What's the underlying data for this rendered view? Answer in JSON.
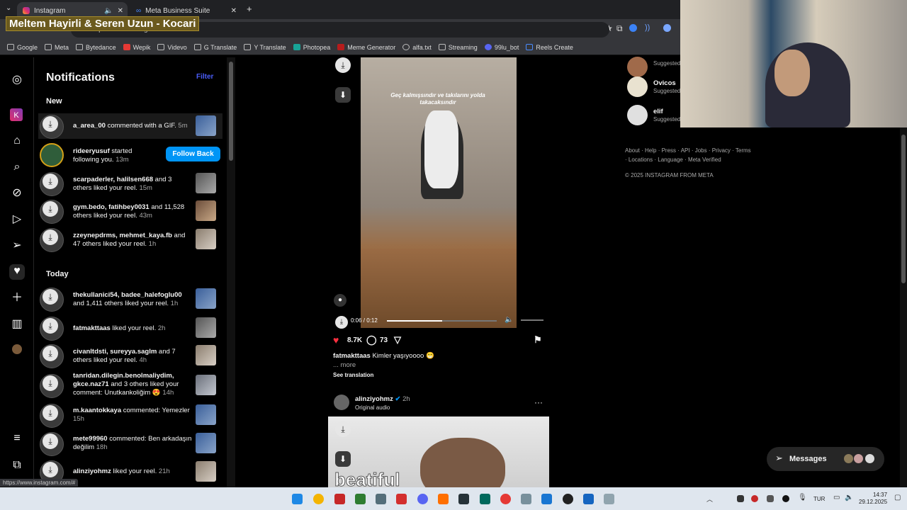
{
  "browser": {
    "tabs": [
      {
        "title": "Instagram",
        "active": true
      },
      {
        "title": "Meta Business Suite",
        "active": false
      }
    ],
    "new_tab_label": "+",
    "url": "https://www.instagram.com",
    "overlay_title": "Meltem Hayirli & Seren Uzun - Kocari",
    "bookmarks": [
      "Google",
      "Meta",
      "Bytedance",
      "Wepik",
      "Videvo",
      "G Translate",
      "Y Translate",
      "Photopea",
      "Meme Generator",
      "alfa.txt",
      "Streaming",
      "99lu_bot",
      "Reels Create"
    ],
    "status_url": "https://www.instagram.com/#"
  },
  "rail": {
    "icons": [
      "instagram-logo",
      "k-app",
      "home",
      "search",
      "explore",
      "reels",
      "messages",
      "notifications",
      "create",
      "dashboard",
      "profile",
      "more",
      "threads"
    ]
  },
  "notifications": {
    "title": "Notifications",
    "filter_label": "Filter",
    "sections": {
      "new": "New",
      "today": "Today"
    },
    "new_items": [
      {
        "user": "a_area_00",
        "text": " commented with a GIF.",
        "time": "5m"
      },
      {
        "user": "rideeryusuf",
        "text": " started following you.",
        "time": "13m",
        "button": "Follow Back"
      },
      {
        "user": "scarpaderler, halilsen668",
        "text": " and 3 others liked your reel.",
        "time": "15m"
      },
      {
        "user": "gym.bedo, fatihbey0031",
        "text": " and 11,528 others liked your reel.",
        "time": "43m"
      },
      {
        "user": "zzeynepdrms, mehmet_kaya.fb",
        "text": " and 47 others liked your reel.",
        "time": "1h"
      }
    ],
    "today_items": [
      {
        "user": "thekullanici54, badee_halefoglu00",
        "text": " and 1,411 others liked your reel.",
        "time": "1h"
      },
      {
        "user": "fatmakttaas",
        "text": " liked your reel.",
        "time": "2h"
      },
      {
        "user": "civanltdsti, sureyya.saglm",
        "text": " and 7 others liked your reel.",
        "time": "4h"
      },
      {
        "user": "tanridan.dilegin.benolmaliydim, gkce.naz71",
        "text": " and 3 others liked your comment: Unutkankoliğim 😍",
        "time": "14h"
      },
      {
        "user": "m.kaantokkaya",
        "text": " commented: Yemezler",
        "time": "15h"
      },
      {
        "user": "mete99960",
        "text": " commented: Ben arkadaşın değilim",
        "time": "18h"
      },
      {
        "user": "alinziyohmz",
        "text": " liked your reel.",
        "time": "21h"
      }
    ]
  },
  "feed": {
    "video_caption": "Geç kalmışsındır ve takılarını yolda takacaksındır",
    "video_time": "0:06 / 0:12",
    "video_progress": 0.5,
    "likes": "8.7K",
    "comments": "73",
    "caption_user": "fatmakttaas",
    "caption_text": "Kimler yaşıyoooo 😁",
    "more": "... more",
    "see_translation": "See translation",
    "post2_user": "alinziyohmz",
    "post2_time": "2h",
    "post2_audio": "Original audio",
    "post2_overlay_word": "beatiful"
  },
  "right": {
    "suggestions": [
      {
        "name": "",
        "sub": "Suggested"
      },
      {
        "name": "Ovicos",
        "sub": "Suggested"
      },
      {
        "name": "elif",
        "sub": "Suggested"
      }
    ],
    "footer_links": "About · Help · Press · API · Jobs · Privacy · Terms · Locations · Language · Meta Verified",
    "copyright": "© 2025 INSTAGRAM FROM META",
    "messages_label": "Messages"
  },
  "taskbar": {
    "lang": "TUR",
    "time": "14:37",
    "date": "29.12.2025"
  },
  "colors": {
    "accent": "#0095f6",
    "heart": "#ff3040",
    "filter": "#4a5df9"
  }
}
